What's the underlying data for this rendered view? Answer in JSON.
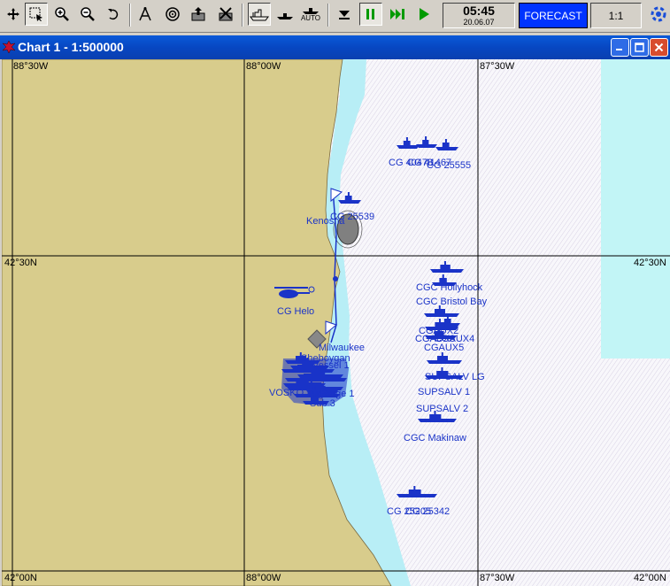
{
  "toolbar": {
    "icons": [
      "move-icon",
      "select-zoom-icon",
      "zoom-in-icon",
      "zoom-out-icon",
      "undo-icon",
      "route-icon",
      "target-icon",
      "export-icon",
      "import-icon",
      "ship-heading-icon",
      "ship-course-icon",
      "ship-auto-icon",
      "down-arrow-icon",
      "pause-icon",
      "fast-forward-icon",
      "play-icon",
      "settings-icon"
    ],
    "auto_label": "AUTO",
    "time": "05:45",
    "date": "20.06.07",
    "forecast_label": "FORECAST",
    "scale_label": "1:1"
  },
  "window": {
    "title": "Chart 1 - 1:500000"
  },
  "chart": {
    "grid_labels": {
      "lon_88_30_top": "88°30W",
      "lon_88_00_top": "88°00W",
      "lon_87_30_top": "87°30W",
      "lat_42_30_left": "42°30N",
      "lat_42_30_right": "42°30N",
      "lat_42_00_left": "42°00N",
      "lon_88_00_bottom": "88°00W",
      "lon_87_30_bottom": "87°30W",
      "lat_42_00_right": "42°00N"
    },
    "unit_labels": [
      "CG 40478",
      "CG 41467",
      "CG 25555",
      "Kenosha",
      "CG 25539",
      "CG Helo",
      "CGC Hollyhock",
      "CGC Bristol Bay",
      "CGAUX2",
      "CGAUX3",
      "CGAUX4",
      "CGAUX5",
      "SUPSALV LG",
      "SUPSALV 1",
      "SUPSALV 2",
      "CGC Makinaw",
      "CG 25205",
      "CG 25342",
      "VOSKO",
      "Milwaukee",
      "Sheboygan",
      "Vessel 1",
      "Tug 1",
      "Barge 1",
      "Sub 3"
    ]
  }
}
